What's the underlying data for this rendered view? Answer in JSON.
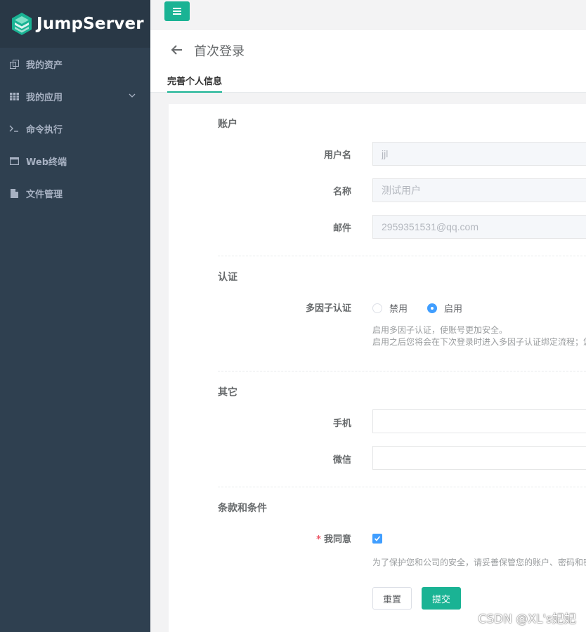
{
  "brand": {
    "name": "JumpServer",
    "accent": "#1ab394",
    "sidebar_bg": "#2f4050"
  },
  "sidebar": {
    "items": [
      {
        "label": "我的资产",
        "icon": "assets-icon"
      },
      {
        "label": "我的应用",
        "icon": "grid-icon",
        "has_submenu": true
      },
      {
        "label": "命令执行",
        "icon": "terminal-icon"
      },
      {
        "label": "Web终端",
        "icon": "window-icon"
      },
      {
        "label": "文件管理",
        "icon": "file-icon"
      }
    ]
  },
  "header": {
    "title": "首次登录",
    "tab": "完善个人信息"
  },
  "form": {
    "account": {
      "section_title": "账户",
      "username_label": "用户名",
      "username_value": "jjl",
      "name_label": "名称",
      "name_value": "测试用户",
      "email_label": "邮件",
      "email_value": "2959351531@qq.com"
    },
    "auth": {
      "section_title": "认证",
      "mfa_label": "多因子认证",
      "option_disable": "禁用",
      "option_enable": "启用",
      "selected": "启用",
      "help_line1": "启用多因子认证，使账号更加安全。",
      "help_line2": "启用之后您将会在下次登录时进入多因子认证绑定流程；您"
    },
    "other": {
      "section_title": "其它",
      "phone_label": "手机",
      "wechat_label": "微信"
    },
    "terms": {
      "section_title": "条款和条件",
      "required_mark": "*",
      "agree_label": "我同意",
      "agree_checked": true,
      "help": "为了保护您和公司的安全，请妥善保管您的账户、密码和密"
    },
    "buttons": {
      "reset": "重置",
      "submit": "提交"
    }
  },
  "watermark": "CSDN @XL's妃妃"
}
